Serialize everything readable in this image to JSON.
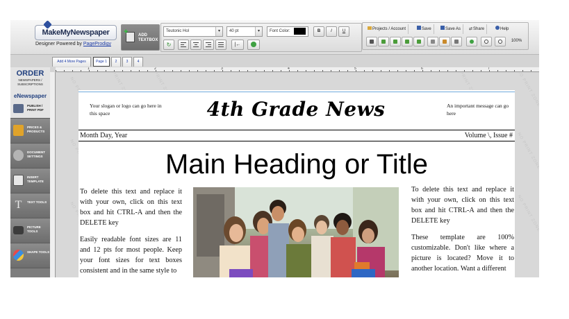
{
  "brand": {
    "logo_text": "MakeMyNewspaper",
    "powered_prefix": "Designer Powered by",
    "powered_link": "PageProdigy"
  },
  "toolbar": {
    "add_textbox": "ADD TEXTBOX",
    "font_family": "Teutonic Hol",
    "font_size": "40 pt",
    "font_color_label": "Font Color:",
    "font_color": "#000000",
    "bold": "B",
    "italic": "I",
    "underline": "U",
    "projects": "Projects / Account",
    "save": "Save",
    "save_as": "Save As",
    "share": "Share",
    "help": "Help",
    "zoom": "100%"
  },
  "tabs": {
    "add_pages": "Add 4 More Pages",
    "page1": "Page 1",
    "page2": "2",
    "page3": "3",
    "page4": "4"
  },
  "sidebar": {
    "order_title": "ORDER",
    "order_sub": "NEWSPAPERS / SUBSCRIPTIONS",
    "enews_title": "eNewspaper",
    "publish": "PUBLISH / PRINT PDF",
    "prices": "PRICES & PRODUCTS",
    "document": "DOCUMENT SETTINGS",
    "insert_template": "INSERT TEMPLATE",
    "text_tools": "TEXT TOOLS",
    "picture_tools": "PICTURE TOOLS",
    "shape_tools": "SHAPE TOOLS"
  },
  "ruler": {
    "marks": [
      "1",
      "2",
      "3",
      "4",
      "5",
      "6",
      "7",
      "8"
    ]
  },
  "watermark_text": "NO PRINT ZONE",
  "newspaper": {
    "slogan": "Your slogan or logo can go here in this space",
    "masthead": "4th Grade News",
    "important": "An important message can go here",
    "date": "Month Day, Year",
    "volume": "Volume \\, Issue #",
    "headline": "Main Heading or Title",
    "left_p1": "To delete this text and replace it with your own, click on this text box and hit CTRL-A and then the DELETE key",
    "left_p2": "Easily readable font sizes are 11 and 12 pts for most people. Keep your font sizes for text boxes consistent and in the same style to",
    "right_p1": "To delete this text and replace it with your own, click on this text box and hit CTRL-A and then the DELETE key",
    "right_p2": "These template are 100% customizable. Don't like where a picture is located? Move it to another location. Want a different"
  },
  "colors": {
    "brand_blue": "#21407f",
    "link_blue": "#1a3aa6",
    "guide_blue": "#6fa8dc",
    "sidebar_gray": "#7d7d7d"
  }
}
